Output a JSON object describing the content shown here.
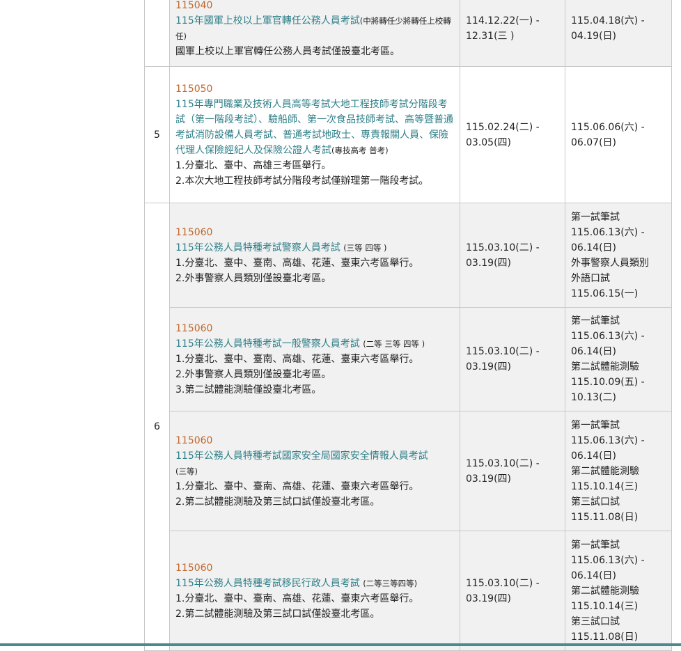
{
  "rows": [
    {
      "code": "115040",
      "title": "115年國軍上校以上軍官轉任公務人員考試",
      "grade": "(中將轉任少將轉任上校轉任)",
      "notes": [
        "國軍上校以上軍官轉任公務人員考試僅設臺北考區。"
      ],
      "registration": "114.12.22(一) -\n12.31(三 )",
      "schedule": [
        "115.04.18(六) -",
        "04.19(日)"
      ]
    },
    {
      "group_number": "5",
      "code": "115050",
      "title": "115年專門職業及技術人員高等考試大地工程技師考試分階段考試（第一階段考試）、驗船師、第一次食品技師考試、高等暨普通考試消防設備人員考試、普通考試地政士、專責報關人員、保險代理人保險經紀人及保險公證人考試",
      "grade": "(專技高考 普考)",
      "notes": [
        "1.分臺北、臺中、高雄三考區舉行。",
        "2.本次大地工程技師考試分階段考試僅辦理第一階段考試。"
      ],
      "registration": "115.02.24(二) -\n03.05(四)",
      "schedule": [
        "115.06.06(六) -",
        "06.07(日)"
      ]
    },
    {
      "group_number": "6",
      "code": "115060",
      "title": "115年公務人員特種考試警察人員考試",
      "grade": "(三等 四等 )",
      "notes": [
        "1.分臺北、臺中、臺南、高雄、花蓮、臺東六考區舉行。",
        "2.外事警察人員類別僅設臺北考區。"
      ],
      "registration": "115.03.10(二) -\n03.19(四)",
      "schedule": [
        "第一試筆試",
        "115.06.13(六) -",
        "06.14(日)",
        "外事警察人員類別",
        "外語口試",
        "115.06.15(一)"
      ]
    },
    {
      "code": "115060",
      "title": "115年公務人員特種考試一般警察人員考試",
      "grade": "(二等 三等 四等 )",
      "notes": [
        "1.分臺北、臺中、臺南、高雄、花蓮、臺東六考區舉行。",
        "2.外事警察人員類別僅設臺北考區。",
        "3.第二試體能測驗僅設臺北考區。"
      ],
      "registration": "115.03.10(二) -\n03.19(四)",
      "schedule": [
        "第一試筆試",
        "115.06.13(六) -",
        "06.14(日)",
        "第二試體能測驗",
        "115.10.09(五) -",
        "10.13(二)"
      ]
    },
    {
      "code": "115060",
      "title": "115年公務人員特種考試國家安全局國家安全情報人員考試",
      "grade": "(三等)",
      "notes": [
        "1.分臺北、臺中、臺南、高雄、花蓮、臺東六考區舉行。",
        "2.第二試體能測驗及第三試口試僅設臺北考區。"
      ],
      "registration": "115.03.10(二) -\n03.19(四)",
      "schedule": [
        "第一試筆試",
        "115.06.13(六) -",
        "06.14(日)",
        "第二試體能測驗",
        "115.10.14(三)",
        "第三試口試",
        "115.11.08(日)"
      ]
    },
    {
      "code": "115060",
      "title": "115年公務人員特種考試移民行政人員考試",
      "grade": "(二等三等四等)",
      "notes": [
        "1.分臺北、臺中、臺南、高雄、花蓮、臺東六考區舉行。",
        "2.第二試體能測驗及第三試口試僅設臺北考區。"
      ],
      "registration": "115.03.10(二) -\n03.19(四)",
      "schedule": [
        "第一試筆試",
        "115.06.13(六) -",
        "06.14(日)",
        "第二試體能測驗",
        "115.10.14(三)",
        "第三試口試",
        "115.11.08(日)"
      ]
    }
  ]
}
